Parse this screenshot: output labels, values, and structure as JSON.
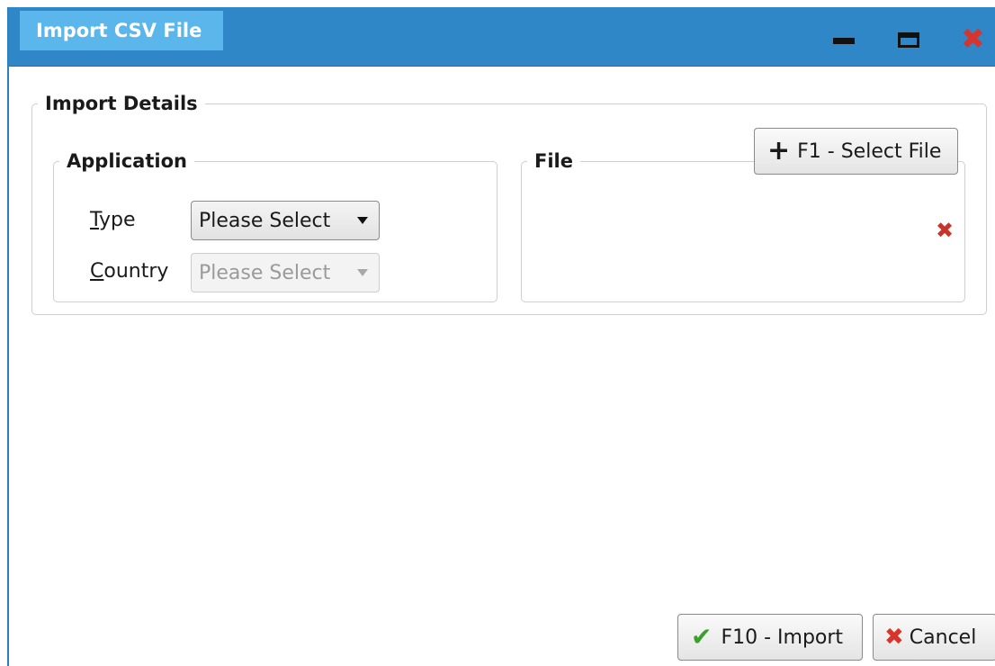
{
  "window": {
    "title": "Import CSV File",
    "controls": {
      "minimize_icon": "minimize-icon",
      "maximize_icon": "maximize-icon",
      "close_icon": "close-icon"
    }
  },
  "import_details": {
    "legend": "Import Details",
    "application": {
      "legend": "Application",
      "type_label_mnemonic": "T",
      "type_label_rest": "ype",
      "type_value": "Please Select",
      "country_label_mnemonic": "C",
      "country_label_rest": "ountry",
      "country_value": "Please Select"
    },
    "file": {
      "legend": "File",
      "select_button_label": "F1 - Select File",
      "clear_icon": "close-icon"
    }
  },
  "footer": {
    "import_label": "F10 - Import",
    "cancel_label": "Cancel"
  },
  "colors": {
    "titlebar": "#2f87c8",
    "title_tab": "#5bb6ec",
    "close_red": "#d9342b",
    "check_green": "#3aa02b"
  }
}
